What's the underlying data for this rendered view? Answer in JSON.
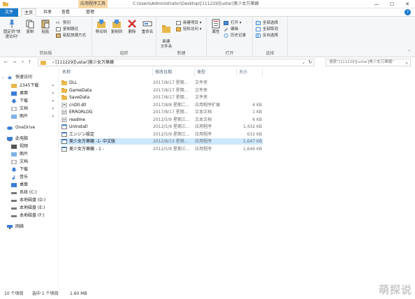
{
  "window": {
    "context_tab": "应用程序工具",
    "path_title": "C:\\Users\\Administrator\\Desktop\\[111229][ustar]美少女万華鏡",
    "controls": [
      "—",
      "☐",
      "✕"
    ]
  },
  "menu": {
    "file": "文件",
    "items": [
      "主页",
      "共享",
      "查看",
      "管理"
    ]
  },
  "ribbon": {
    "clipboard": {
      "label": "剪贴板",
      "pin_label": "固定到\"快速访问\"",
      "copy": "复制",
      "paste": "粘贴",
      "cut": "剪切",
      "copy_path": "复制路径",
      "paste_shortcut": "粘贴快捷方式"
    },
    "organize": {
      "label": "组织",
      "move_to": "移动到",
      "copy_to": "复制到",
      "delete": "删除",
      "rename": "重命名"
    },
    "new": {
      "label": "新建",
      "new_folder": "新建\n文件夹",
      "new_item": "新建项目 ▾",
      "easy_access": "轻松访问 ▾"
    },
    "open": {
      "label": "打开",
      "properties": "属性",
      "open": "打开 ▾",
      "edit": "编辑",
      "history": "历史记录"
    },
    "select": {
      "label": "选择",
      "select_all": "全部选择",
      "select_none": "全部取消",
      "invert": "反向选择"
    }
  },
  "address": {
    "crumb": "› [111229][ustar]美少女万華鏡",
    "search_placeholder": "搜索\"[111229][ustar]美少女万華鏡\""
  },
  "nav": {
    "quick_access": "快速访问",
    "items": [
      {
        "label": "2345下载",
        "pinned": true
      },
      {
        "label": "桌面",
        "pinned": true
      },
      {
        "label": "下载",
        "pinned": true
      },
      {
        "label": "文档",
        "pinned": true
      },
      {
        "label": "图片",
        "pinned": true
      }
    ],
    "onedrive": "OneDrive",
    "this_pc": "此电脑",
    "pc_items": [
      "视频",
      "图片",
      "文档",
      "下载",
      "音乐",
      "桌面",
      "系统 (C:)",
      "本地磁盘 (D:)",
      "本地磁盘 (E:)",
      "本地磁盘 (F:)"
    ],
    "network": "网络",
    "pin_glyph": "📌"
  },
  "columns": {
    "name": "名称",
    "date": "修改日期",
    "type": "类型",
    "size": "大小"
  },
  "files": [
    {
      "name": "DLL",
      "date": "2017/8/17 星期...",
      "type": "文件夹",
      "size": "",
      "icon": "folder-icon"
    },
    {
      "name": "GameData",
      "date": "2017/8/17 星期...",
      "type": "文件夹",
      "size": "",
      "icon": "folder-icon"
    },
    {
      "name": "SaveData",
      "date": "2017/8/17 星期...",
      "type": "文件夹",
      "size": "",
      "icon": "folder-icon"
    },
    {
      "name": "cnDll.dll",
      "date": "2017/8/8 星期二...",
      "type": "应用程序扩展",
      "size": "4 KB",
      "icon": "dll-icon"
    },
    {
      "name": "ERRORLOG",
      "date": "2017/8/17 星期...",
      "type": "文本文档",
      "size": "1 KB",
      "icon": "text-icon"
    },
    {
      "name": "readme",
      "date": "2012/5/9 星期三...",
      "type": "文本文档",
      "size": "6 KB",
      "icon": "text-icon"
    },
    {
      "name": "UnInstall",
      "date": "2012/5/9 星期三...",
      "type": "应用程序",
      "size": "1,432 KB",
      "icon": "app-icon"
    },
    {
      "name": "エンジン設定",
      "date": "2012/5/9 星期三...",
      "type": "应用程序",
      "size": "632 KB",
      "icon": "app-icon"
    },
    {
      "name": "美少女万華鏡 -1- 中文版",
      "date": "2012/8/13 星期...",
      "type": "应用程序",
      "size": "1,647 KB",
      "icon": "app-icon",
      "selected": true
    },
    {
      "name": "美少女万華鏡 - 1 -",
      "date": "2012/5/9 星期三...",
      "type": "应用程序",
      "size": "1,646 KB",
      "icon": "app-icon"
    }
  ],
  "status": {
    "count": "10 个项目",
    "selected": "选中 1 个项目",
    "size": "1.60 MB"
  },
  "watermark": "萌探说",
  "colors": {
    "accent": "#1979ca",
    "folder": "#e8b84a",
    "selection": "#cce8ff",
    "context_tab": "#f6d7a5"
  }
}
